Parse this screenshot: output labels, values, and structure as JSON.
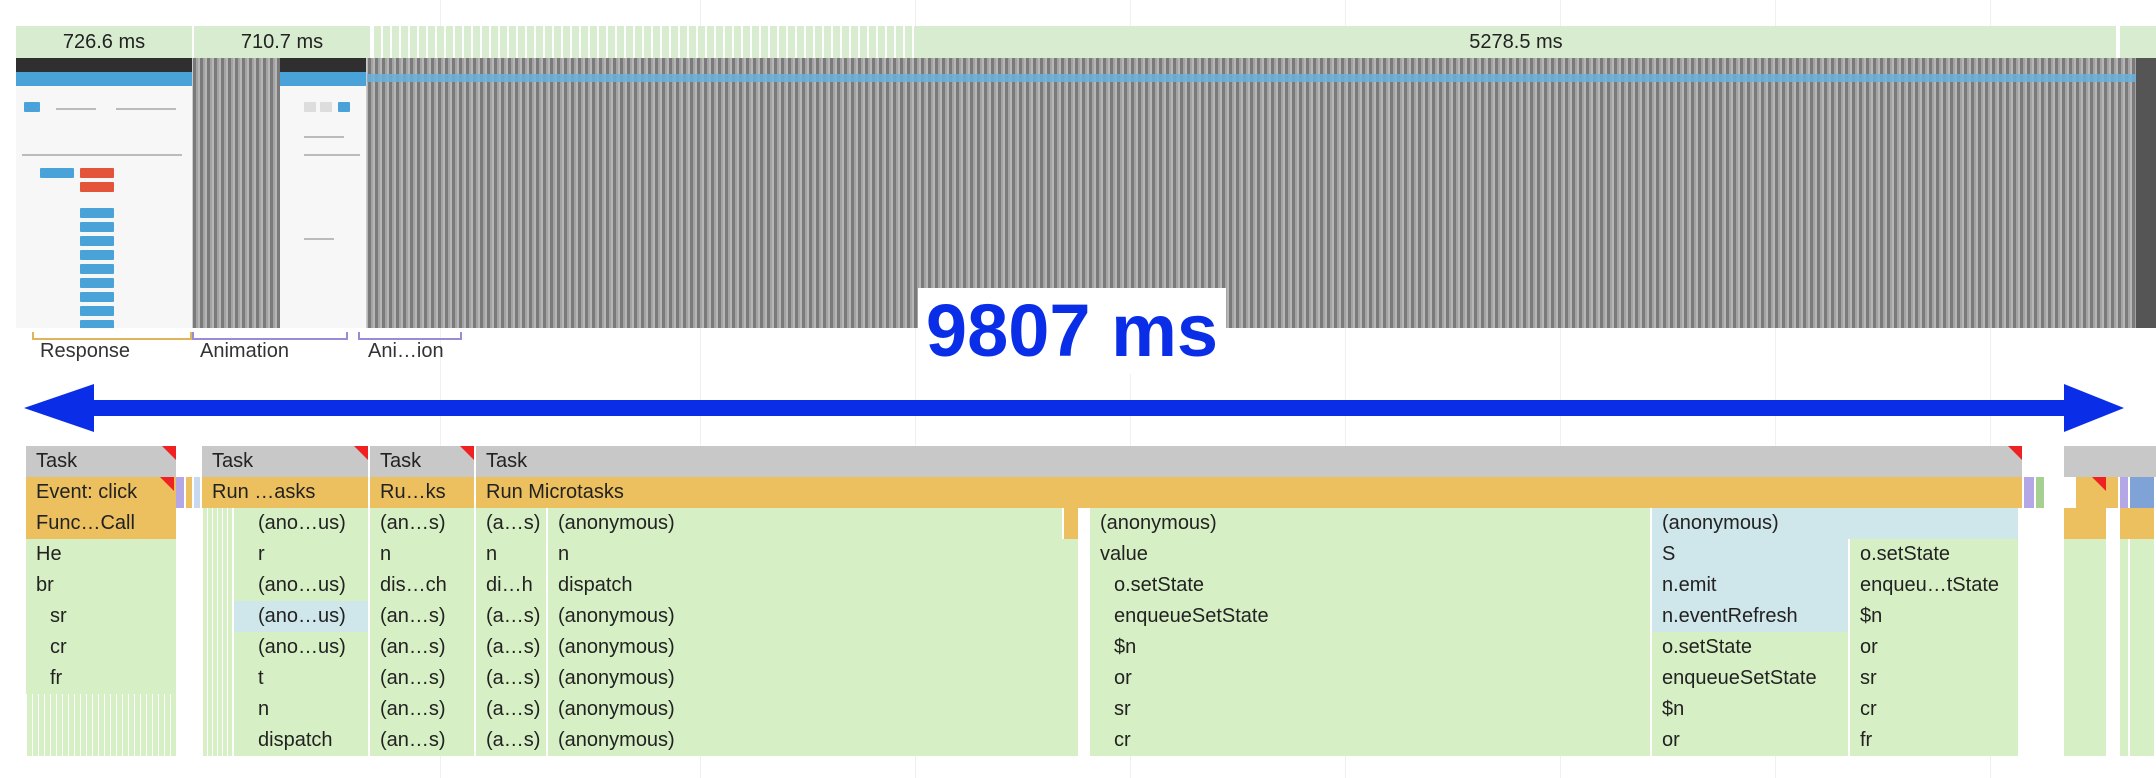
{
  "timeline": {
    "segments": [
      "726.6 ms",
      "710.7 ms",
      "5278.5 ms"
    ]
  },
  "markers": {
    "response": "Response",
    "animation": "Animation",
    "animation2": "Ani…ion"
  },
  "annotation": {
    "duration_label": "9807 ms",
    "arrow_color": "#0a2ee8"
  },
  "flame": {
    "tasks": [
      "Task",
      "Task",
      "Task",
      "Task"
    ],
    "row2": [
      "Event: click",
      "Run …asks",
      "Ru…ks",
      "Run Microtasks"
    ],
    "col1": [
      "Func…Call",
      "He",
      "br",
      "sr",
      "cr",
      "fr"
    ],
    "col2": [
      "(ano…us)",
      "r",
      "(ano…us)",
      "(ano…us)",
      "(ano…us)",
      "t",
      "n",
      "dispatch"
    ],
    "col3": [
      "(an…s)",
      "n",
      "dis…ch",
      "(an…s)",
      "(an…s)",
      "(an…s)",
      "(an…s)",
      "(an…s)"
    ],
    "col4a": [
      "(a…s)",
      "n",
      "di…h",
      "(a…s)",
      "(a…s)",
      "(a…s)",
      "(a…s)",
      "(a…s)"
    ],
    "col4b": [
      "(anonymous)",
      "n",
      "dispatch",
      "(anonymous)",
      "(anonymous)",
      "(anonymous)",
      "(anonymous)",
      "(anonymous)"
    ],
    "col5": [
      "(anonymous)",
      "value",
      "o.setState",
      "enqueueSetState",
      "$n",
      "or",
      "sr",
      "cr"
    ],
    "col6": [
      "(anonymous)",
      "S",
      "n.emit",
      "n.eventRefresh",
      "o.setState",
      "enqueueSetState",
      "$n",
      "or"
    ],
    "col7": [
      "o.setState",
      "enqueu…tState",
      "$n",
      "or",
      "sr",
      "cr",
      "fr"
    ]
  },
  "colors": {
    "task": "#c8c8c8",
    "scripting": "#ecc05f",
    "function": "#d6efc4",
    "highlight": "#cfe6ea",
    "frames": "#d8ecd0"
  }
}
